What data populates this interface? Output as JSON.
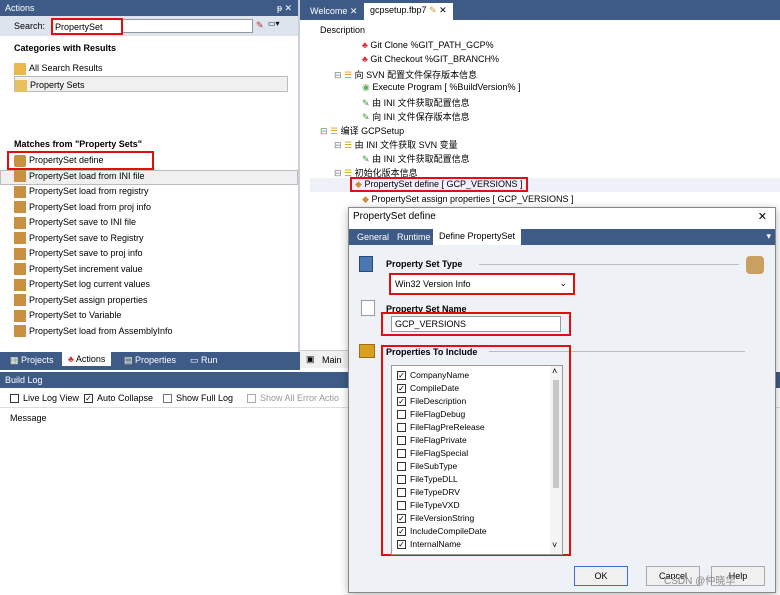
{
  "actions": {
    "title": "Actions",
    "pin": "ᵽ ✕",
    "search_label": "Search:",
    "search_value": "PropertySet",
    "categories_header": "Categories with Results",
    "categories": [
      "All Search Results",
      "Property Sets"
    ],
    "matches_header": "Matches from \"Property Sets\"",
    "matches": [
      "PropertySet define",
      "PropertySet load from INI file",
      "PropertySet load from registry",
      "PropertySet load from proj info",
      "PropertySet save to INI file",
      "PropertySet save to Registry",
      "PropertySet save to proj info",
      "PropertySet increment value",
      "PropertySet log current values",
      "PropertySet assign properties",
      "PropertySet to Variable",
      "PropertySet load from AssemblyInfo"
    ]
  },
  "bottom_tabs": [
    "Projects",
    "Actions",
    "Properties",
    "Run"
  ],
  "build_log": {
    "title": "Build Log",
    "live_log": "Live Log View",
    "auto_collapse": "Auto Collapse",
    "full_log": "Show Full Log",
    "show_errors": "Show All Error Actio",
    "message_col": "Message"
  },
  "editor": {
    "tab_welcome": "Welcome",
    "tab_file": "gcpsetup.fbp7",
    "description": "Description",
    "main_tab": "Main",
    "tree": [
      "Git Clone %GIT_PATH_GCP%",
      "Git Checkout %GIT_BRANCH%",
      "向 SVN 配置文件保存版本信息",
      "Execute Program [ %BuildVersion% ]",
      "由 INI 文件获取配置信息",
      "向 INI 文件保存版本信息",
      "编译 GCPSetup",
      "由 INI 文件获取 SVN 变量",
      "由 INI 文件获取配置信息",
      "初始化版本信息",
      "PropertySet define [ GCP_VERSIONS ]",
      "PropertySet assign properties [ GCP_VERSIONS ]"
    ]
  },
  "dialog": {
    "title": "PropertySet define",
    "close": "✕",
    "tabs": [
      "General",
      "Runtime",
      "Define PropertySet"
    ],
    "type_label": "Property Set Type",
    "type_value": "Win32 Version Info",
    "name_label": "Property Set Name",
    "name_value": "GCP_VERSIONS",
    "props_label": "Properties To Include",
    "properties": [
      {
        "name": "CompanyName",
        "checked": true
      },
      {
        "name": "CompileDate",
        "checked": true
      },
      {
        "name": "FileDescription",
        "checked": true
      },
      {
        "name": "FileFlagDebug",
        "checked": false
      },
      {
        "name": "FileFlagPreRelease",
        "checked": false
      },
      {
        "name": "FileFlagPrivate",
        "checked": false
      },
      {
        "name": "FileFlagSpecial",
        "checked": false
      },
      {
        "name": "FileSubType",
        "checked": false
      },
      {
        "name": "FileTypeDLL",
        "checked": false
      },
      {
        "name": "FileTypeDRV",
        "checked": false
      },
      {
        "name": "FileTypeVXD",
        "checked": false
      },
      {
        "name": "FileVersionString",
        "checked": true
      },
      {
        "name": "IncludeCompileDate",
        "checked": true
      },
      {
        "name": "InternalName",
        "checked": true
      }
    ],
    "ok": "OK",
    "cancel": "Cancel",
    "help": "Help"
  },
  "watermark": "CSDN @仲晓华"
}
